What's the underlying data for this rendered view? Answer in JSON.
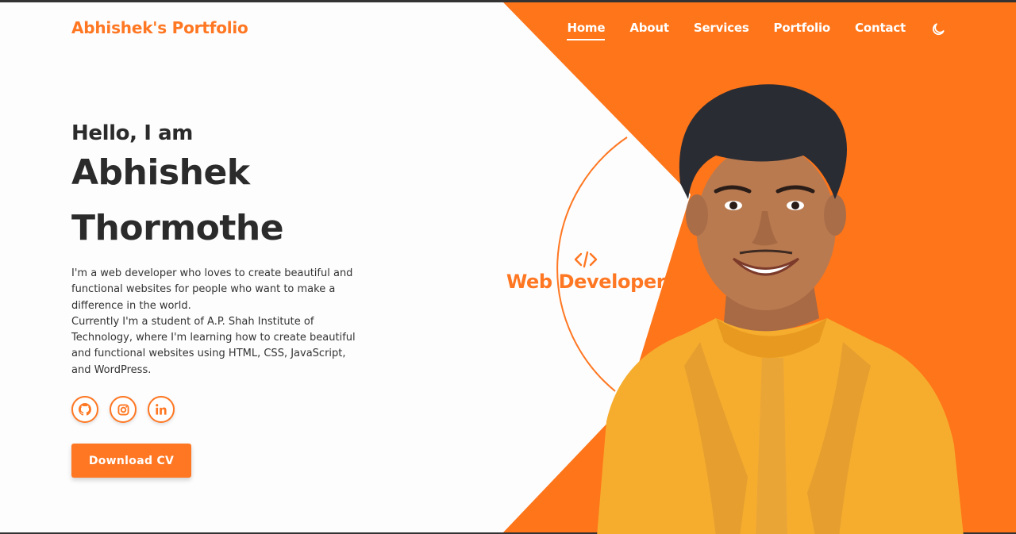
{
  "brand": {
    "logo": "Abhishek's Portfolio"
  },
  "nav": {
    "items": [
      {
        "label": "Home",
        "active": true
      },
      {
        "label": "About",
        "active": false
      },
      {
        "label": "Services",
        "active": false
      },
      {
        "label": "Portfolio",
        "active": false
      },
      {
        "label": "Contact",
        "active": false
      }
    ],
    "theme_icon": "moon-icon"
  },
  "hero": {
    "greeting": "Hello, I am",
    "first_name": "Abhishek",
    "last_name": "Thormothe",
    "bio_line1": "I'm a web developer who loves to create beautiful and functional websites for people who want to make a difference in the world.",
    "bio_line2": "Currently I'm a student of A.P. Shah Institute of Technology, where I'm learning how to create beautiful and functional websites using HTML, CSS, JavaScript, and WordPress.",
    "socials": [
      "github-icon",
      "instagram-icon",
      "linkedin-icon"
    ],
    "cta": "Download CV"
  },
  "role": {
    "icon": "code-icon",
    "title": "Web Developer"
  },
  "colors": {
    "accent": "#ff7722",
    "text_dark": "#2b2b2b",
    "background": "#fdfdfd"
  }
}
